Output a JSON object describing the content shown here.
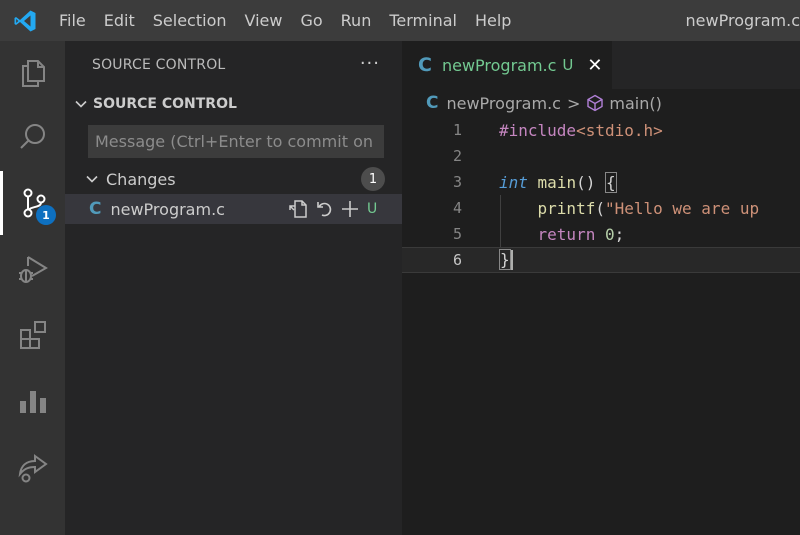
{
  "titlebar": {
    "logo_icon": "vscode-logo-icon",
    "menu": [
      "File",
      "Edit",
      "Selection",
      "View",
      "Go",
      "Run",
      "Terminal",
      "Help"
    ],
    "window_title": "newProgram.c"
  },
  "activitybar": {
    "items": [
      {
        "name": "explorer",
        "icon": "files-icon"
      },
      {
        "name": "search",
        "icon": "search-icon"
      },
      {
        "name": "source-control",
        "icon": "source-control-icon",
        "badge": "1",
        "active": true
      },
      {
        "name": "run-debug",
        "icon": "run-debug-icon"
      },
      {
        "name": "extensions",
        "icon": "extensions-icon"
      },
      {
        "name": "charts",
        "icon": "bar-chart-icon"
      },
      {
        "name": "live-share",
        "icon": "live-share-icon"
      }
    ]
  },
  "sidebar": {
    "title": "SOURCE CONTROL",
    "more_actions": "···",
    "section_title": "SOURCE CONTROL",
    "commit_placeholder": "Message (Ctrl+Enter to commit on …",
    "changes": {
      "label": "Changes",
      "count": "1",
      "files": [
        {
          "icon_letter": "C",
          "name": "newProgram.c",
          "status": "U",
          "actions": [
            "open-file-icon",
            "discard-changes-icon",
            "stage-changes-icon"
          ]
        }
      ]
    }
  },
  "editor": {
    "tab": {
      "icon_letter": "C",
      "label": "newProgram.c",
      "status": "U",
      "close": "✕"
    },
    "breadcrumb": {
      "file": "newProgram.c",
      "separator": ">",
      "symbol": "main()"
    },
    "lines": [
      {
        "number": "1"
      },
      {
        "number": "2"
      },
      {
        "number": "3"
      },
      {
        "number": "4"
      },
      {
        "number": "5"
      },
      {
        "number": "6"
      }
    ],
    "code": {
      "l1_directive": "#include",
      "l1_header": "<stdio.h>",
      "l3_type": "int",
      "l3_name": "main",
      "l3_parens": "() ",
      "l3_brace": "{",
      "l4_fn": "printf",
      "l4_paren": "(",
      "l4_string": "\"Hello we are up",
      "l5_kw": "return",
      "l5_num": "0",
      "l5_semi": ";",
      "l6_brace": "}"
    }
  },
  "colors": {
    "titlebar_bg": "#3c3c3c",
    "activitybar_bg": "#333333",
    "sidebar_bg": "#252526",
    "editor_bg": "#1e1e1e",
    "badge_blue": "#0e70c0",
    "untracked_green": "#73c991",
    "c_icon_blue": "#519aba"
  }
}
